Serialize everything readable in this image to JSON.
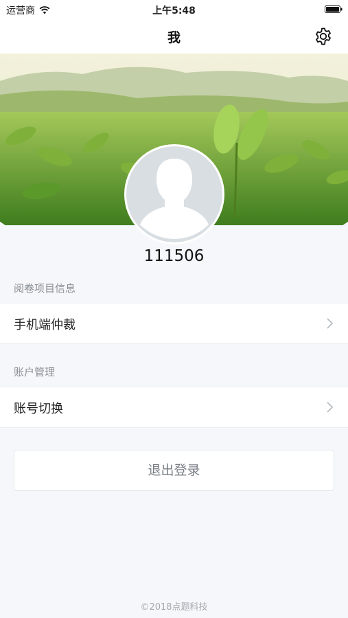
{
  "status_bar": {
    "carrier": "运营商",
    "time": "上午5:48",
    "wifi_icon": "wifi-icon",
    "battery_icon": "battery-icon"
  },
  "nav": {
    "title": "我",
    "settings_icon": "gear-icon"
  },
  "profile": {
    "username": "111506",
    "avatar_icon": "default-avatar-icon"
  },
  "sections": [
    {
      "label": "阅卷项目信息",
      "items": [
        {
          "label": "手机端仲裁",
          "icon": "chevron-right-icon"
        }
      ]
    },
    {
      "label": "账户管理",
      "items": [
        {
          "label": "账号切换",
          "icon": "chevron-right-icon"
        }
      ]
    }
  ],
  "logout": {
    "label": "退出登录"
  },
  "footer": {
    "copyright": "©2018点题科技"
  },
  "colors": {
    "background": "#f5f7fa",
    "banner_green": "#5f9a2c",
    "secondary_text": "#8a8f96"
  }
}
